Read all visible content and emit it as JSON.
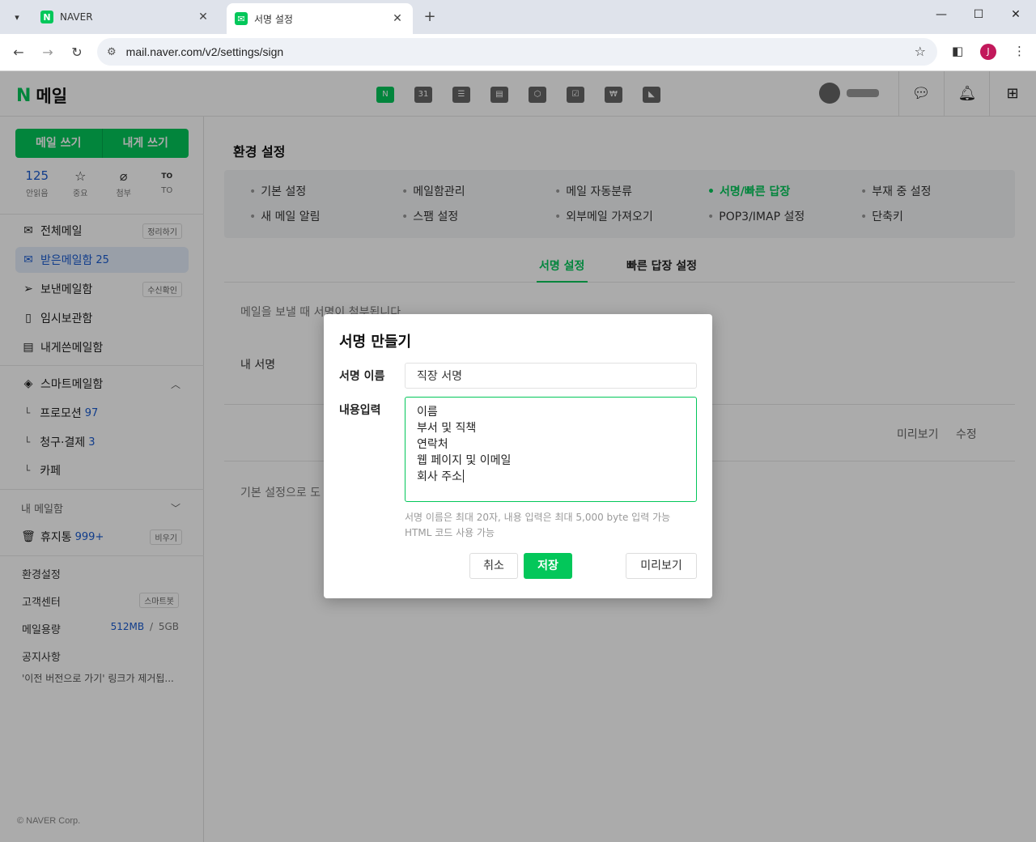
{
  "browser": {
    "tabs": [
      {
        "title": "NAVER",
        "favicon": "N"
      },
      {
        "title": "서명 설정",
        "favicon": "mail"
      }
    ],
    "url": "mail.naver.com/v2/settings/sign",
    "profile_initial": "J"
  },
  "header": {
    "logo_n": "N",
    "logo_text": "메일",
    "services": [
      {
        "icon": "mail-icon",
        "glyph": "N"
      },
      {
        "icon": "calendar-icon",
        "glyph": "31"
      },
      {
        "icon": "memo-icon",
        "glyph": "☰"
      },
      {
        "icon": "contacts-icon",
        "glyph": "▤"
      },
      {
        "icon": "mybox-icon",
        "glyph": "⬡"
      },
      {
        "icon": "todo-icon",
        "glyph": "☑"
      },
      {
        "icon": "household-icon",
        "glyph": "₩"
      },
      {
        "icon": "bookmark-icon",
        "glyph": "◣"
      }
    ]
  },
  "sidebar": {
    "write_mail": "메일 쓰기",
    "write_self": "내게 쓰기",
    "quick": [
      {
        "value": "125",
        "label": "안읽음"
      },
      {
        "icon": "☆",
        "label": "중요"
      },
      {
        "icon": "⌀",
        "label": "첨부"
      },
      {
        "icon": "TO",
        "label": "TO"
      }
    ],
    "folders": [
      {
        "label": "전체메일",
        "pill": "정리하기"
      },
      {
        "label": "받은메일함",
        "count": "25"
      },
      {
        "label": "보낸메일함",
        "pill": "수신확인"
      },
      {
        "label": "임시보관함"
      },
      {
        "label": "내게쓴메일함"
      }
    ],
    "smart": {
      "label": "스마트메일함",
      "subs": [
        {
          "label": "프로모션",
          "count": "97"
        },
        {
          "label": "청구·결제",
          "count": "3"
        },
        {
          "label": "카페"
        }
      ]
    },
    "my_mailbox": "내 메일함",
    "trash": {
      "label": "휴지통",
      "count": "999+",
      "pill": "비우기"
    },
    "links": {
      "settings": "환경설정",
      "support": "고객센터",
      "support_pill": "스마트봇",
      "storage_label": "메일용량",
      "storage_used": "512MB",
      "storage_sep": "/",
      "storage_total": "5GB",
      "notice": "공지사항",
      "notice_text": "'이전 버전으로 가기' 링크가 제거됩..."
    },
    "copyright": "© NAVER Corp."
  },
  "main": {
    "title": "환경 설정",
    "menu": [
      {
        "label": "기본 설정"
      },
      {
        "label": "메일함관리"
      },
      {
        "label": "메일 자동분류"
      },
      {
        "label": "서명/빠른 답장",
        "active": true
      },
      {
        "label": "부재 중 설정"
      },
      {
        "label": "새 메일 알림"
      },
      {
        "label": "스팸 설정"
      },
      {
        "label": "외부메일 가져오기"
      },
      {
        "label": "POP3/IMAP 설정"
      },
      {
        "label": "단축키"
      }
    ],
    "subtabs": [
      "서명 설정",
      "빠른 답장 설정"
    ],
    "info": "메일을 보낼 때 서명이 첨부됩니다",
    "my_signature": "내 서명",
    "preview": "미리보기",
    "edit": "수정",
    "footer": "기본 설정으로 도"
  },
  "modal": {
    "title": "서명 만들기",
    "name_label": "서명 이름",
    "name_value": "직장 서명",
    "content_label": "내용입력",
    "content_lines": [
      "이름",
      "부서 및 직책",
      "연락처",
      "웹 페이지 및 이메일",
      "회사 주소"
    ],
    "help_line1": "서명 이름은 최대 20자, 내용 입력은 최대 5,000 byte 입력 가능",
    "help_line2": "HTML 코드 사용 가능",
    "cancel": "취소",
    "save": "저장",
    "preview": "미리보기"
  },
  "colors": {
    "brand": "#03c75a",
    "link": "#1a5bd0"
  }
}
